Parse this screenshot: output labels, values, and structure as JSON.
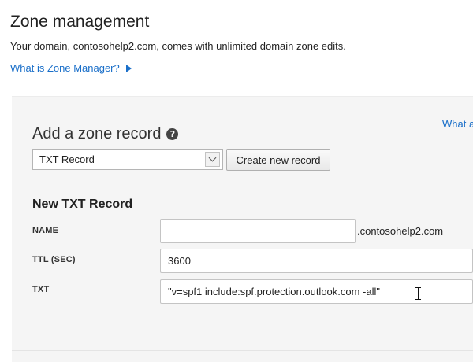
{
  "page": {
    "title": "Zone management",
    "subtitle": "Your domain, contosohelp2.com, comes with unlimited domain zone edits.",
    "help_link": "What is Zone Manager?"
  },
  "panel": {
    "heading": "Add a zone record",
    "right_link": "What a",
    "record_type": {
      "selected": "TXT Record"
    },
    "create_button": "Create new record",
    "form": {
      "heading": "New TXT Record",
      "fields": {
        "name": {
          "label": "NAME",
          "value": "",
          "suffix": ".contosohelp2.com"
        },
        "ttl": {
          "label": "TTL (SEC)",
          "value": "3600"
        },
        "txt": {
          "label": "TXT",
          "value": "\"v=spf1 include:spf.protection.outlook.com -all\""
        }
      }
    }
  },
  "icons": {
    "help_arrow": "play-icon",
    "question": "question-circle-icon",
    "select_arrow": "chevron-down-icon",
    "cursor": "text-cursor-icon"
  },
  "colors": {
    "link": "#1a6fc9",
    "panel_background": "#f5f5f5"
  }
}
